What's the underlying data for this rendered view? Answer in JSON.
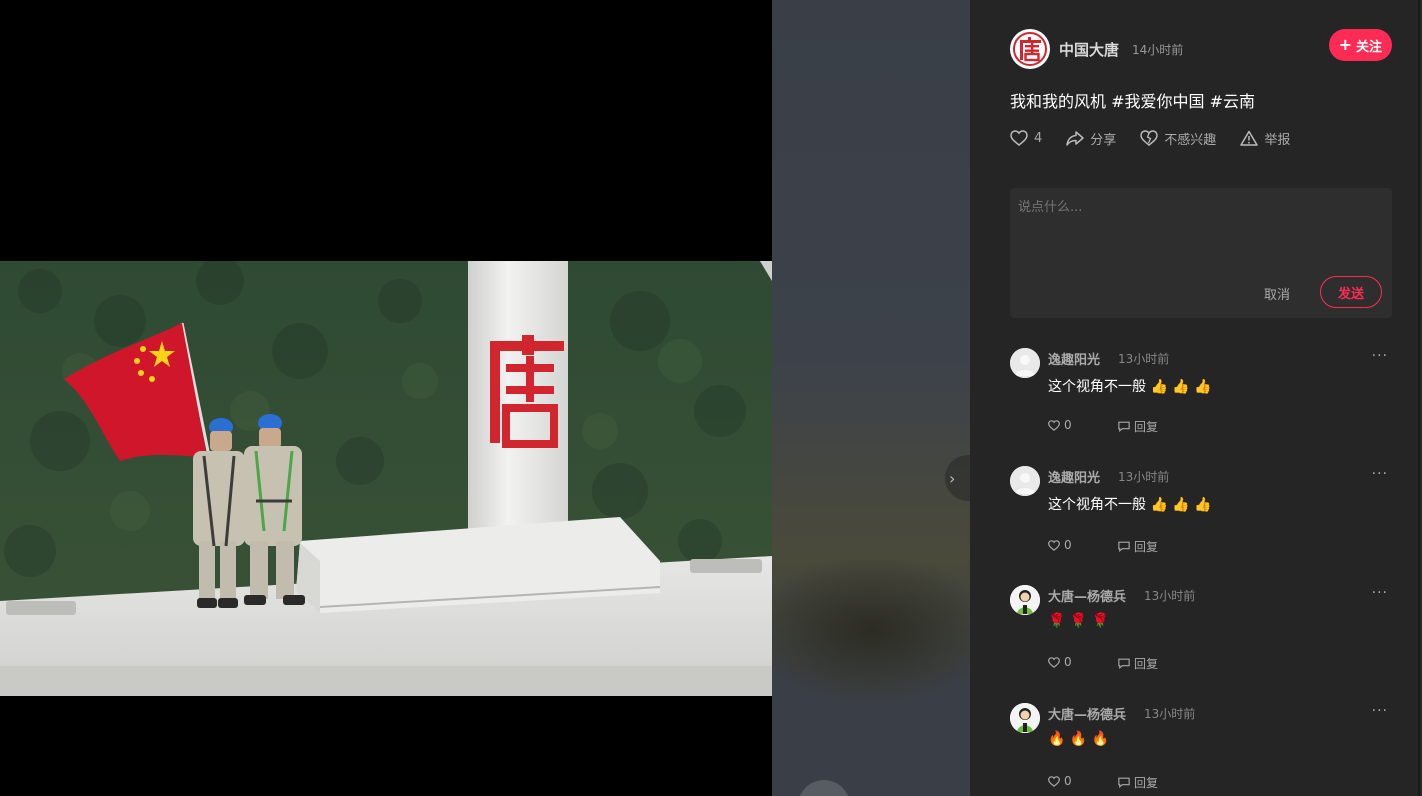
{
  "video": {
    "scene": "two workers with a red flag atop a wind turbine nacelle",
    "tower_logo_char": "唐"
  },
  "author": {
    "name": "中国大唐",
    "time": "14小时前",
    "logo_char": "唐",
    "follow_label": "关注",
    "follow_icon": "plus-icon"
  },
  "post": {
    "text": "我和我的风机 #我爱你中国 #云南"
  },
  "actions": {
    "like_count": "4",
    "share_label": "分享",
    "not_interested_label": "不感兴趣",
    "report_label": "举报"
  },
  "comment_box": {
    "placeholder": "说点什么...",
    "cancel_label": "取消",
    "send_label": "发送"
  },
  "comments": [
    {
      "name": "逸趣阳光",
      "time": "13小时前",
      "text": "这个视角不一般 👍 👍 👍",
      "likes": "0",
      "reply_label": "回复"
    },
    {
      "name": "逸趣阳光",
      "time": "13小时前",
      "text": "这个视角不一般 👍 👍 👍",
      "likes": "0",
      "reply_label": "回复"
    },
    {
      "name": "大唐—杨德兵",
      "time": "13小时前",
      "text": "🌹 🌹 🌹",
      "likes": "0",
      "reply_label": "回复"
    },
    {
      "name": "大唐—杨德兵",
      "time": "13小时前",
      "text": "🔥 🔥 🔥",
      "likes": "0",
      "reply_label": "回复"
    }
  ],
  "colors": {
    "accent": "#fe2c55",
    "panel_bg": "#252525",
    "flag_red": "#d0162a",
    "logo_red": "#d2262e"
  }
}
